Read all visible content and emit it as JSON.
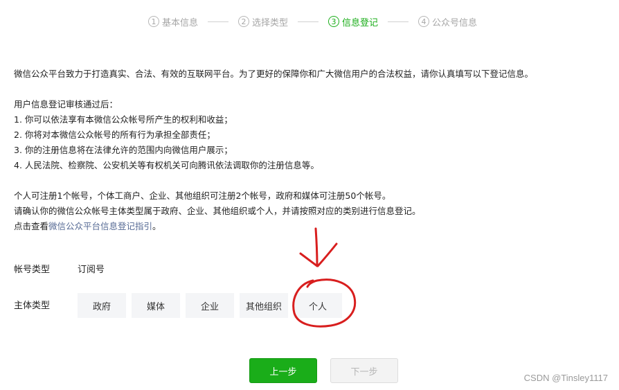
{
  "stepper": {
    "steps": [
      {
        "num": "1",
        "label": "基本信息",
        "state": "done"
      },
      {
        "num": "2",
        "label": "选择类型",
        "state": "done"
      },
      {
        "num": "3",
        "label": "信息登记",
        "state": "active"
      },
      {
        "num": "4",
        "label": "公众号信息",
        "state": "pending"
      }
    ],
    "active_color": "#1aad19"
  },
  "intro": {
    "lead": "微信公众平台致力于打造真实、合法、有效的互联网平台。为了更好的保障你和广大微信用户的合法权益，请你认真填写以下登记信息。",
    "after_review_title": "用户信息登记审核通过后：",
    "items": [
      "1. 你可以依法享有本微信公众帐号所产生的权利和收益；",
      "2. 你将对本微信公众帐号的所有行为承担全部责任；",
      "3. 你的注册信息将在法律允许的范围内向微信用户展示；",
      "4. 人民法院、检察院、公安机关等有权机关可向腾讯依法调取你的注册信息等。"
    ],
    "quota": "个人可注册1个帐号，个体工商户、企业、其他组织可注册2个帐号，政府和媒体可注册50个帐号。",
    "confirm": "请确认你的微信公众帐号主体类型属于政府、企业、其他组织或个人，并请按照对应的类别进行信息登记。",
    "guide_prefix": "点击查看",
    "guide_link": "微信公众平台信息登记指引",
    "guide_suffix": "。"
  },
  "form": {
    "account_type_label": "帐号类型",
    "account_type_value": "订阅号",
    "subject_type_label": "主体类型",
    "subject_options": [
      "政府",
      "媒体",
      "企业",
      "其他组织",
      "个人"
    ]
  },
  "annotation": {
    "color": "#d81e1e",
    "highlighted_option": "个人"
  },
  "footer": {
    "prev_label": "上一步",
    "next_label": "下一步"
  },
  "watermark": "CSDN @Tinsley1117"
}
